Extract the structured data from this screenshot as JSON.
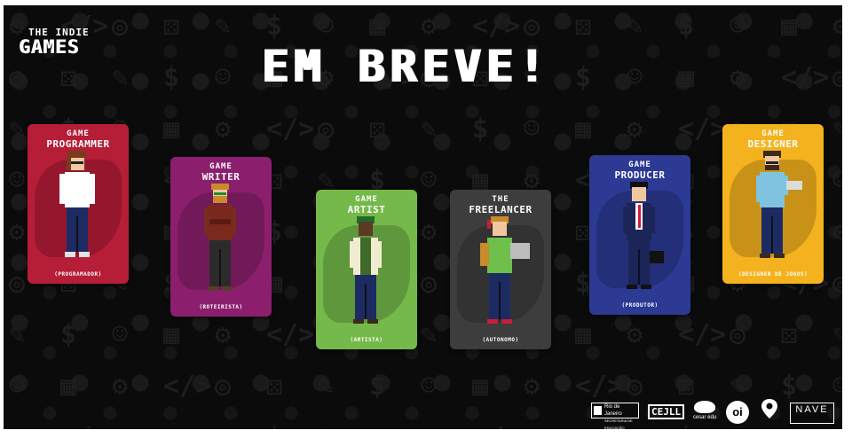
{
  "brand": {
    "small": "THE INDIE",
    "big": "GAMES"
  },
  "headline": "EM BREVE!",
  "cards": [
    {
      "line1": "GAME",
      "line2": "PROGRAMMER",
      "role": "(PROGRAMADOR)",
      "color": "#b61d37"
    },
    {
      "line1": "GAME",
      "line2": "WRITER",
      "role": "(ROTEIRISTA)",
      "color": "#8b1f6e"
    },
    {
      "line1": "GAME",
      "line2": "ARTIST",
      "role": "(ARTISTA)",
      "color": "#74b94a"
    },
    {
      "line1": "THE",
      "line2": "FREELANCER",
      "role": "(AUTONOMO)",
      "color": "#3d3d3d"
    },
    {
      "line1": "GAME",
      "line2": "PRODUCER",
      "role": "(PRODUTOR)",
      "color": "#2c3a94"
    },
    {
      "line1": "GAME",
      "line2": "DESIGNER",
      "role": "(DESIGNER DE JOGOS)",
      "color": "#f4b21e"
    }
  ],
  "logos": {
    "rio": {
      "name": "Rio de Janeiro",
      "sub": "SECRETARIA DE EDUCAÇÃO"
    },
    "cejll": "CEJLL",
    "cesar": "cesar edu",
    "oi": "oi",
    "nave": {
      "name": "NAVE"
    }
  }
}
